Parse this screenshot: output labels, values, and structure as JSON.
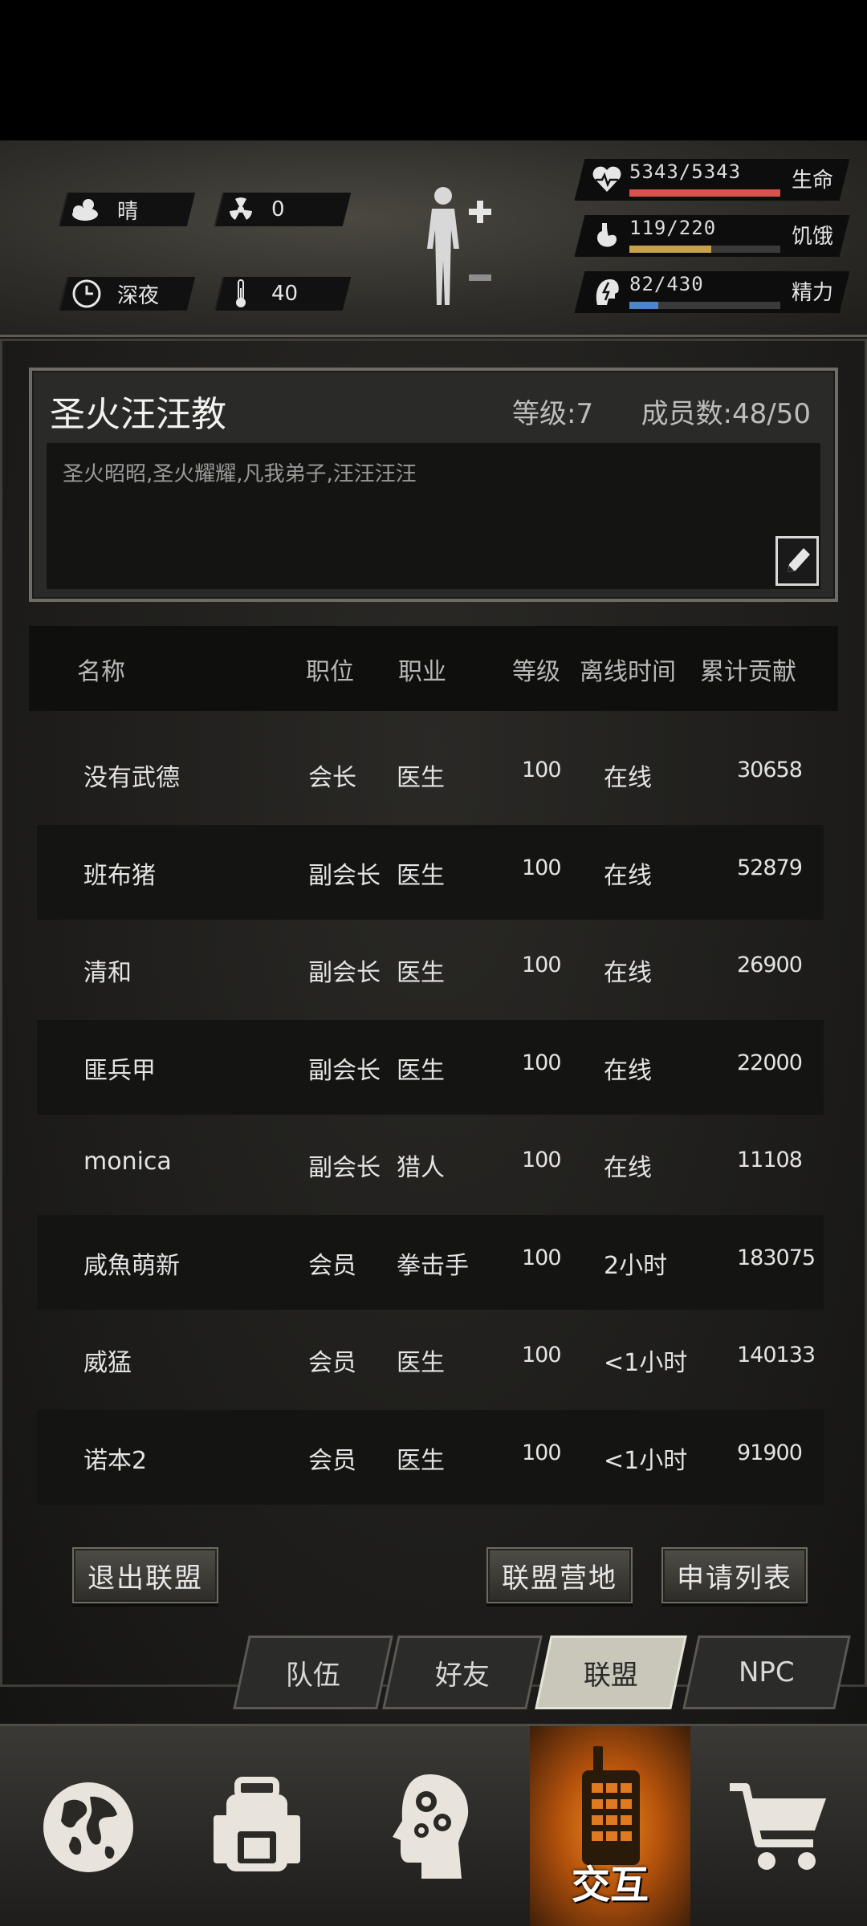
{
  "status": {
    "weather": "晴",
    "radiation": "0",
    "time_of_day": "深夜",
    "temperature": "40"
  },
  "vitals": [
    {
      "label": "生命",
      "value": "5343/5343",
      "fraction": 1.0,
      "color": "#d9534a",
      "icon": "heart-icon"
    },
    {
      "label": "饥饿",
      "value": "119/220",
      "fraction": 0.54,
      "color": "#c8a24a",
      "icon": "stomach-icon"
    },
    {
      "label": "精力",
      "value": "82/430",
      "fraction": 0.19,
      "color": "#4a86c8",
      "icon": "energy-icon"
    }
  ],
  "guild": {
    "name": "圣火汪汪教",
    "level": "等级:7",
    "members": "成员数:48/50",
    "description": "圣火昭昭,圣火耀耀,凡我弟子,汪汪汪汪"
  },
  "table": {
    "headers": [
      "名称",
      "职位",
      "职业",
      "等级",
      "离线时间",
      "累计贡献"
    ],
    "rows": [
      [
        "没有武德",
        "会长",
        "医生",
        "100",
        "在线",
        "30658"
      ],
      [
        "班布猪",
        "副会长",
        "医生",
        "100",
        "在线",
        "52879"
      ],
      [
        "清和",
        "副会长",
        "医生",
        "100",
        "在线",
        "26900"
      ],
      [
        "匪兵甲",
        "副会长",
        "医生",
        "100",
        "在线",
        "22000"
      ],
      [
        "monica",
        "副会长",
        "猎人",
        "100",
        "在线",
        "11108"
      ],
      [
        "咸魚萌新",
        "会员",
        "拳击手",
        "100",
        "2小时",
        "183075"
      ],
      [
        "威猛",
        "会员",
        "医生",
        "100",
        "<1小时",
        "140133"
      ],
      [
        "诺本2",
        "会员",
        "医生",
        "100",
        "<1小时",
        "91900"
      ]
    ]
  },
  "buttons": {
    "leave": "退出联盟",
    "camp": "联盟营地",
    "applications": "申请列表"
  },
  "tabs": [
    "队伍",
    "好友",
    "联盟",
    "NPC"
  ],
  "active_tab": "联盟",
  "nav": {
    "active_label": "交互"
  }
}
